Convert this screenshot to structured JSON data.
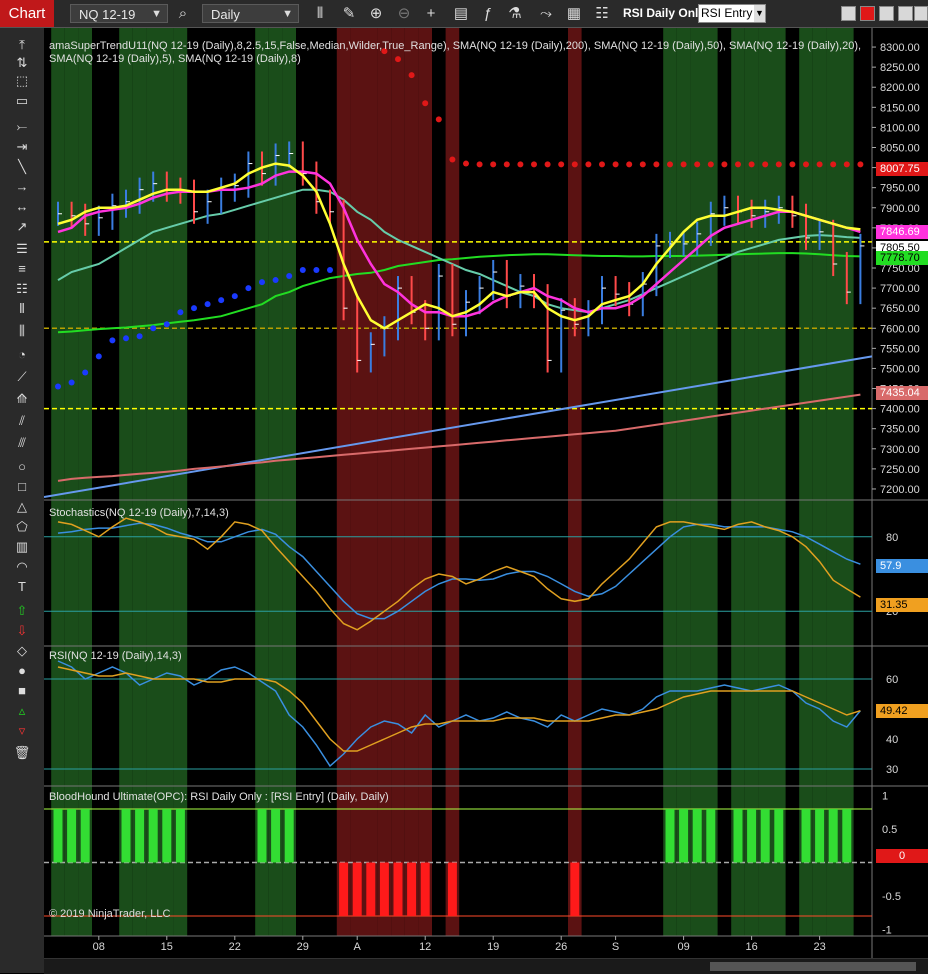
{
  "toolbar": {
    "tab_label": "Chart",
    "instrument": "NQ 12-19",
    "interval": "Daily",
    "strategy_label": "RSI Daily Only",
    "strategy_select": "RSI Entry",
    "icons": [
      "search-icon",
      "bar-type-icon",
      "draw-icon",
      "zoom-in-icon",
      "zoom-out-icon",
      "crosshair-icon",
      "properties-icon",
      "indicators-icon",
      "strategies-icon",
      "chart-trader-icon",
      "data-box-icon",
      "attach-icon"
    ]
  },
  "panels": {
    "price_title": "amaSuperTrendU11(NQ 12-19 (Daily),8,2.5,15,False,Median,Wilder,True_Range), SMA(NQ 12-19 (Daily),200), SMA(NQ 12-19 (Daily),50), SMA(NQ 12-19 (Daily),20), SMA(NQ 12-19 (Daily),5), SMA(NQ 12-19 (Daily),8)",
    "stoch_title": "Stochastics(NQ 12-19 (Daily),7,14,3)",
    "rsi_title": "RSI(NQ 12-19 (Daily),14,3)",
    "bh_title": "BloodHound Ultimate(OPC): RSI Daily Only : [RSI Entry] (Daily, Daily)"
  },
  "price_axis": [
    "8300.00",
    "8250.00",
    "8200.00",
    "8150.00",
    "8100.00",
    "8050.00",
    "8000.00",
    "7950.00",
    "7900.00",
    "7850.00",
    "7800.00",
    "7750.00",
    "7700.00",
    "7650.00",
    "7600.00",
    "7550.00",
    "7500.00",
    "7450.00",
    "7400.00",
    "7350.00",
    "7300.00",
    "7250.00",
    "7200.00"
  ],
  "price_flags": {
    "supertrend": "8007.75",
    "sma5": "7846.69",
    "last": "7805.50",
    "sma50": "7778.70",
    "sma200": "7435.04"
  },
  "stoch_axis": [
    "80",
    "20"
  ],
  "stoch_flags": {
    "d": "57.9",
    "k": "31.35"
  },
  "rsi_axis": [
    "60",
    "50",
    "40",
    "30"
  ],
  "rsi_flag": "49.42",
  "bh_axis": [
    "1",
    "0.5",
    "-0.5",
    "-1"
  ],
  "bh_flag": "0",
  "x_axis": [
    "08",
    "15",
    "22",
    "29",
    "A",
    "12",
    "19",
    "26",
    "S",
    "09",
    "16",
    "23"
  ],
  "copyright": "© 2019 NinjaTrader, LLC",
  "colors": {
    "up_bar": "#3a7de0",
    "down_bar": "#ff4a4a",
    "sma5": "#ffff33",
    "sma8": "#ff33dd",
    "sma20": "#66ccaa",
    "sma50": "#22dd22",
    "sma200": "#d86a6a",
    "trendline": "#6699ee",
    "bull_band": "#1e5a1e",
    "bear_band": "#6b1515"
  },
  "chart_data": {
    "type": "candlestick",
    "instrument": "NQ 12-19",
    "interval": "Daily",
    "ylim": [
      7175,
      8335
    ],
    "dates": [
      "07-03",
      "07-05",
      "07-08",
      "07-09",
      "07-10",
      "07-11",
      "07-12",
      "07-15",
      "07-16",
      "07-17",
      "07-18",
      "07-19",
      "07-22",
      "07-23",
      "07-24",
      "07-25",
      "07-26",
      "07-29",
      "07-30",
      "07-31",
      "08-01",
      "08-02",
      "08-05",
      "08-06",
      "08-07",
      "08-08",
      "08-09",
      "08-12",
      "08-13",
      "08-14",
      "08-15",
      "08-16",
      "08-19",
      "08-20",
      "08-21",
      "08-22",
      "08-23",
      "08-26",
      "08-27",
      "08-28",
      "08-29",
      "08-30",
      "09-03",
      "09-04",
      "09-05",
      "09-06",
      "09-09",
      "09-10",
      "09-11",
      "09-12",
      "09-13",
      "09-16",
      "09-17",
      "09-18",
      "09-19",
      "09-20",
      "09-23",
      "09-24",
      "09-25",
      "09-26"
    ],
    "close": [
      7885,
      7880,
      7860,
      7875,
      7905,
      7915,
      7945,
      7960,
      7945,
      7940,
      7890,
      7915,
      7945,
      7955,
      8010,
      7985,
      8030,
      8035,
      7985,
      7915,
      7890,
      7650,
      7520,
      7560,
      7600,
      7700,
      7640,
      7600,
      7730,
      7610,
      7665,
      7700,
      7740,
      7680,
      7705,
      7680,
      7520,
      7645,
      7610,
      7640,
      7700,
      7685,
      7660,
      7710,
      7805,
      7810,
      7810,
      7835,
      7885,
      7900,
      7890,
      7880,
      7890,
      7900,
      7880,
      7825,
      7840,
      7760,
      7690,
      7805
    ],
    "supertrend": [
      7455,
      7465,
      7490,
      7530,
      7570,
      7575,
      7580,
      7600,
      7610,
      7640,
      7650,
      7660,
      7670,
      7680,
      7700,
      7715,
      7720,
      7730,
      7745,
      7745,
      7745,
      null,
      null,
      null,
      8290,
      8270,
      8230,
      8160,
      8120,
      8020,
      8010,
      8008,
      8008,
      8008,
      8008,
      8008,
      8008,
      8008,
      8008,
      8008,
      8008,
      8008,
      8008,
      8008,
      8008,
      8008,
      8008,
      8008,
      8008,
      8008,
      8008,
      8008,
      8008,
      8008,
      8008,
      8008,
      8008,
      8008,
      8008,
      8008
    ],
    "sma200": [
      7220,
      7225,
      7228,
      7230,
      7232,
      7235,
      7238,
      7240,
      7243,
      7246,
      7250,
      7253,
      7256,
      7259,
      7263,
      7266,
      7270,
      7273,
      7276,
      7279,
      7282,
      7285,
      7288,
      7291,
      7294,
      7297,
      7300,
      7303,
      7306,
      7309,
      7312,
      7315,
      7318,
      7321,
      7324,
      7327,
      7330,
      7333,
      7336,
      7339,
      7342,
      7345,
      7350,
      7355,
      7360,
      7365,
      7370,
      7375,
      7380,
      7385,
      7390,
      7395,
      7400,
      7405,
      7410,
      7415,
      7420,
      7425,
      7430,
      7435
    ],
    "sma50": [
      7590,
      7592,
      7595,
      7598,
      7600,
      7602,
      7605,
      7608,
      7612,
      7616,
      7620,
      7625,
      7630,
      7640,
      7650,
      7660,
      7680,
      7690,
      7705,
      7715,
      7725,
      7730,
      7735,
      7738,
      7745,
      7755,
      7760,
      7765,
      7770,
      7772,
      7775,
      7778,
      7780,
      7782,
      7783,
      7784,
      7784,
      7783,
      7782,
      7781,
      7780,
      7780,
      7779,
      7779,
      7780,
      7780,
      7780,
      7781,
      7782,
      7783,
      7784,
      7785,
      7786,
      7787,
      7787,
      7786,
      7784,
      7782,
      7780,
      7779
    ],
    "sma20": [
      7720,
      7740,
      7750,
      7760,
      7780,
      7800,
      7820,
      7840,
      7850,
      7860,
      7870,
      7880,
      7885,
      7895,
      7905,
      7915,
      7925,
      7935,
      7945,
      7945,
      7940,
      7920,
      7890,
      7870,
      7840,
      7820,
      7805,
      7790,
      7775,
      7760,
      7745,
      7735,
      7720,
      7705,
      7690,
      7680,
      7660,
      7650,
      7645,
      7640,
      7650,
      7660,
      7670,
      7685,
      7700,
      7715,
      7730,
      7745,
      7760,
      7775,
      7790,
      7800,
      7810,
      7820,
      7825,
      7830,
      7832,
      7830,
      7827,
      7825
    ],
    "sma8": [
      7840,
      7850,
      7880,
      7890,
      7895,
      7900,
      7910,
      7925,
      7935,
      7940,
      7940,
      7940,
      7945,
      7945,
      7950,
      7960,
      7980,
      7990,
      7990,
      7985,
      7960,
      7900,
      7820,
      7760,
      7710,
      7690,
      7660,
      7640,
      7640,
      7630,
      7630,
      7640,
      7665,
      7680,
      7690,
      7700,
      7680,
      7670,
      7650,
      7640,
      7650,
      7650,
      7660,
      7680,
      7710,
      7740,
      7770,
      7800,
      7830,
      7850,
      7860,
      7870,
      7880,
      7890,
      7890,
      7880,
      7870,
      7860,
      7850,
      7840
    ],
    "sma5": [
      7860,
      7870,
      7890,
      7900,
      7900,
      7905,
      7920,
      7935,
      7945,
      7945,
      7940,
      7940,
      7950,
      7960,
      7985,
      8000,
      8010,
      8005,
      7980,
      7940,
      7860,
      7760,
      7680,
      7620,
      7600,
      7620,
      7640,
      7660,
      7650,
      7630,
      7640,
      7660,
      7690,
      7680,
      7690,
      7690,
      7650,
      7630,
      7620,
      7630,
      7660,
      7670,
      7680,
      7710,
      7760,
      7800,
      7840,
      7870,
      7880,
      7880,
      7890,
      7900,
      7900,
      7895,
      7890,
      7880,
      7870,
      7860,
      7850,
      7846
    ],
    "trendline": {
      "from": [
        0,
        7180
      ],
      "to": [
        59,
        7530
      ]
    },
    "h_levels": [
      7815,
      7600,
      7400
    ],
    "stochastics": {
      "ylim": [
        0,
        100
      ],
      "k": [
        92,
        90,
        85,
        80,
        88,
        95,
        92,
        88,
        82,
        80,
        78,
        70,
        80,
        92,
        90,
        85,
        72,
        60,
        48,
        36,
        22,
        10,
        5,
        12,
        20,
        28,
        38,
        46,
        50,
        48,
        42,
        46,
        52,
        56,
        52,
        48,
        38,
        30,
        28,
        30,
        42,
        52,
        62,
        75,
        88,
        92,
        92,
        90,
        88,
        86,
        90,
        92,
        88,
        85,
        80,
        72,
        60,
        45,
        38,
        31.35
      ],
      "d": [
        83,
        84,
        86,
        87,
        87,
        89,
        91,
        90,
        87,
        83,
        80,
        76,
        76,
        80,
        84,
        86,
        82,
        72,
        64,
        52,
        40,
        28,
        18,
        14,
        14,
        20,
        28,
        36,
        42,
        46,
        46,
        45,
        46,
        50,
        52,
        52,
        48,
        42,
        36,
        32,
        34,
        40,
        50,
        60,
        70,
        80,
        88,
        90,
        90,
        88,
        88,
        88,
        88,
        86,
        84,
        80,
        74,
        68,
        62,
        57.9
      ],
      "levels": [
        80,
        20
      ]
    },
    "rsi": {
      "ylim": [
        25,
        68
      ],
      "rsi": [
        66,
        64,
        60,
        62,
        64,
        62,
        58,
        60,
        62,
        61,
        58,
        60,
        63,
        64,
        62,
        59,
        56,
        48,
        44,
        38,
        31,
        35,
        40,
        44,
        46,
        45,
        42,
        48,
        44,
        46,
        48,
        46,
        47,
        49,
        47,
        46,
        44,
        48,
        46,
        48,
        50,
        49,
        48,
        50,
        54,
        56,
        56,
        56,
        57,
        58,
        57,
        56,
        57,
        58,
        56,
        52,
        50,
        46,
        44,
        49.42
      ],
      "signal": [
        64,
        63,
        62,
        61,
        61,
        62,
        61,
        60,
        60,
        60,
        60,
        59,
        59,
        60,
        60,
        60,
        59,
        56,
        52,
        46,
        40,
        36,
        36,
        38,
        40,
        42,
        44,
        45,
        45,
        46,
        46,
        46,
        46,
        47,
        47,
        47,
        46,
        46,
        46,
        46,
        47,
        48,
        48,
        49,
        50,
        52,
        54,
        55,
        56,
        56,
        56,
        56,
        56,
        56,
        56,
        54,
        52,
        50,
        48,
        49.42
      ],
      "levels": [
        60,
        30
      ]
    },
    "bloodhound": {
      "ylim": [
        -1.1,
        1.1
      ],
      "signal": [
        1,
        1,
        1,
        0,
        0,
        1,
        1,
        1,
        1,
        1,
        0,
        0,
        0,
        0,
        0,
        1,
        1,
        1,
        0,
        0,
        0,
        -1,
        -1,
        -1,
        -1,
        -1,
        -1,
        -1,
        0,
        -1,
        0,
        0,
        0,
        0,
        0,
        0,
        0,
        0,
        -1,
        0,
        0,
        0,
        0,
        0,
        0,
        1,
        1,
        1,
        1,
        0,
        1,
        1,
        1,
        1,
        0,
        1,
        1,
        1,
        1,
        0
      ],
      "levels": [
        0.8,
        0,
        -0.8
      ]
    }
  }
}
